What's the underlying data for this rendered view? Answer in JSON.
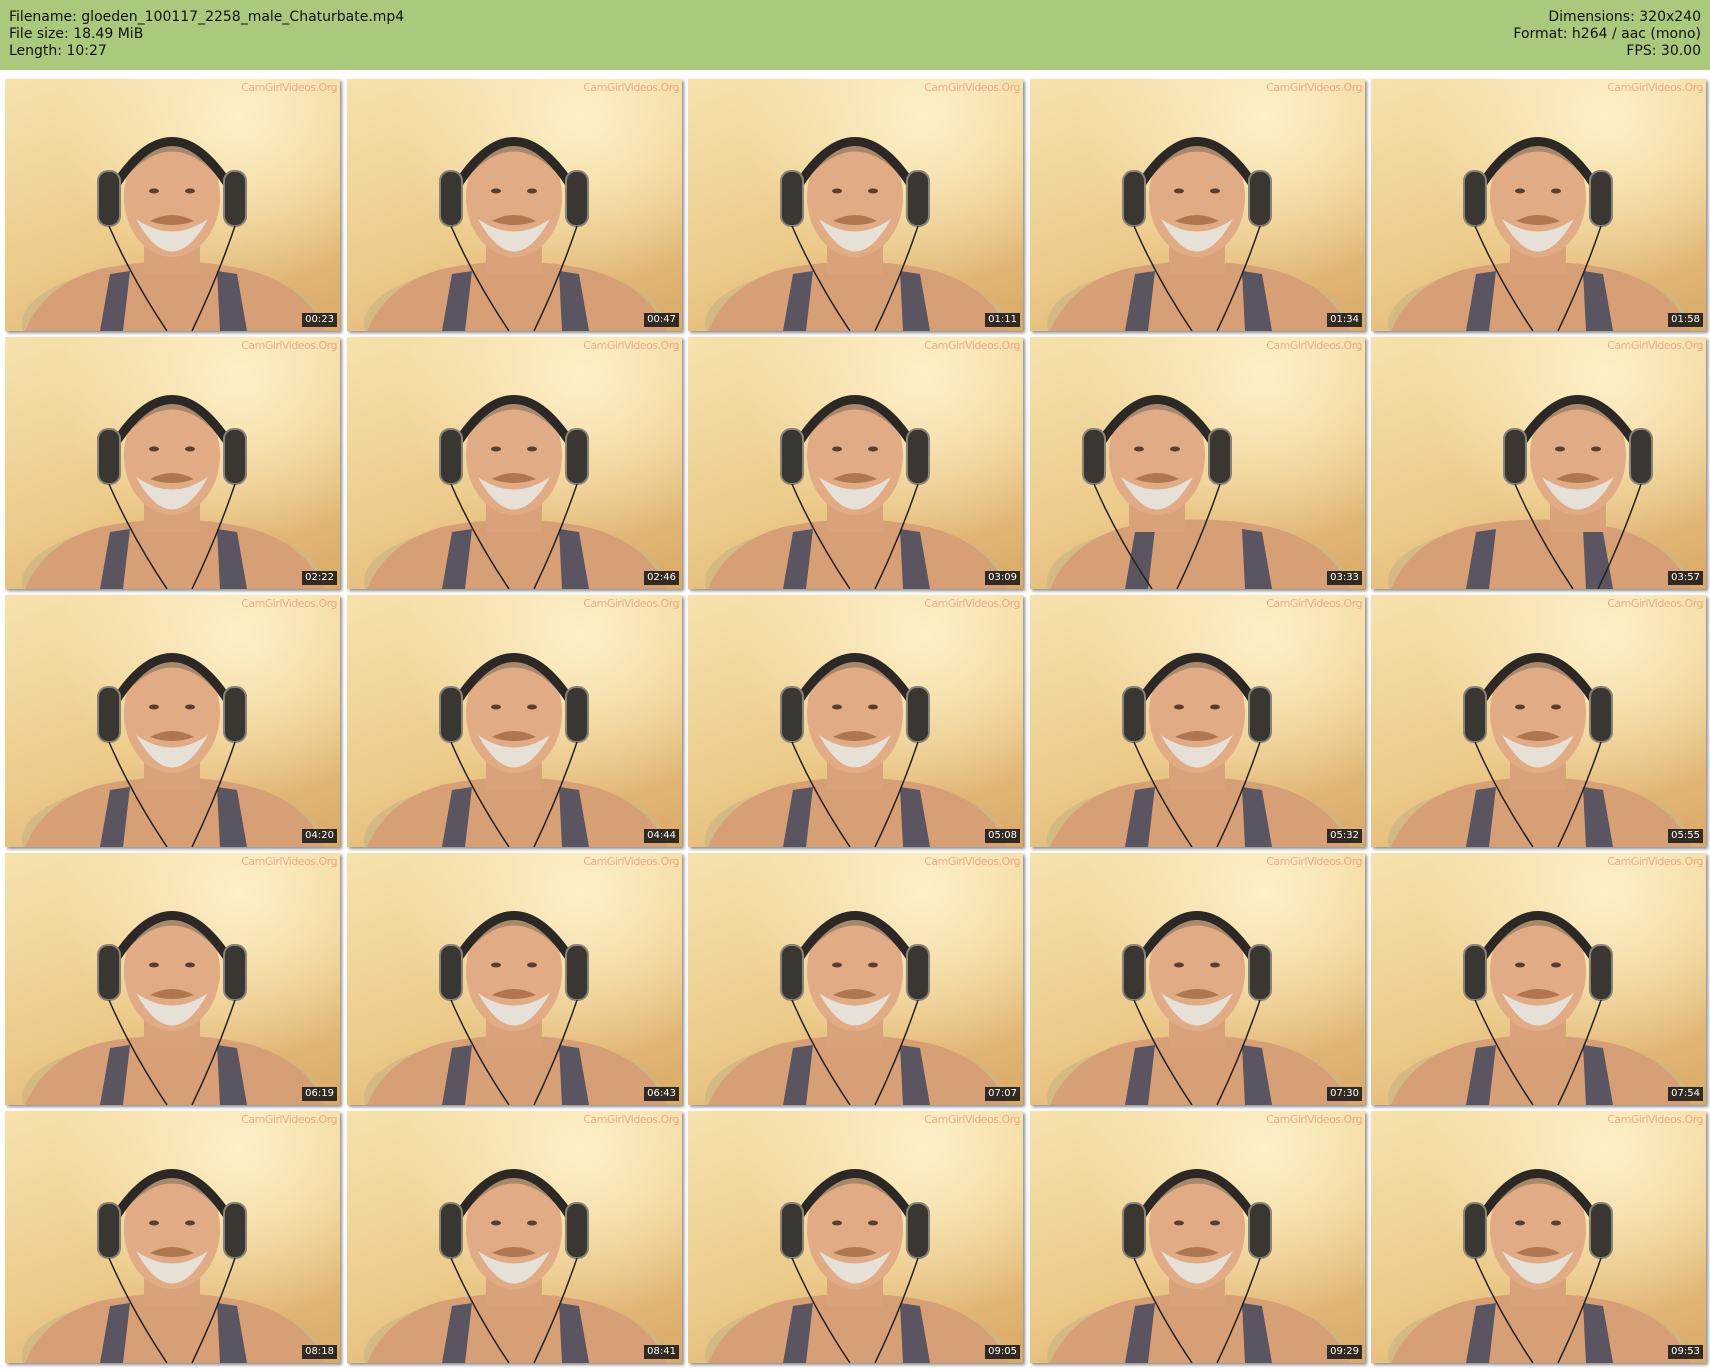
{
  "header": {
    "filename": "Filename: gloeden_100117_2258_male_Chaturbate.mp4",
    "file_size": "File size: 18.49 MiB",
    "length": "Length: 10:27",
    "dimensions": "Dimensions: 320x240",
    "format": "Format: h264 / aac (mono)",
    "fps": "FPS: 30.00"
  },
  "colors": {
    "header_bg": "#abc97c",
    "timestamp_bg": "#141414"
  },
  "watermark": "CamGirlVideos.Org",
  "thumbnails": [
    {
      "time": "00:23"
    },
    {
      "time": "00:47"
    },
    {
      "time": "01:11"
    },
    {
      "time": "01:34"
    },
    {
      "time": "01:58"
    },
    {
      "time": "02:22"
    },
    {
      "time": "02:46"
    },
    {
      "time": "03:09"
    },
    {
      "time": "03:33"
    },
    {
      "time": "03:57"
    },
    {
      "time": "04:20"
    },
    {
      "time": "04:44"
    },
    {
      "time": "05:08"
    },
    {
      "time": "05:32"
    },
    {
      "time": "05:55"
    },
    {
      "time": "06:19"
    },
    {
      "time": "06:43"
    },
    {
      "time": "07:07"
    },
    {
      "time": "07:30"
    },
    {
      "time": "07:54"
    },
    {
      "time": "08:18"
    },
    {
      "time": "08:41"
    },
    {
      "time": "09:05"
    },
    {
      "time": "09:29"
    },
    {
      "time": "09:53"
    }
  ]
}
